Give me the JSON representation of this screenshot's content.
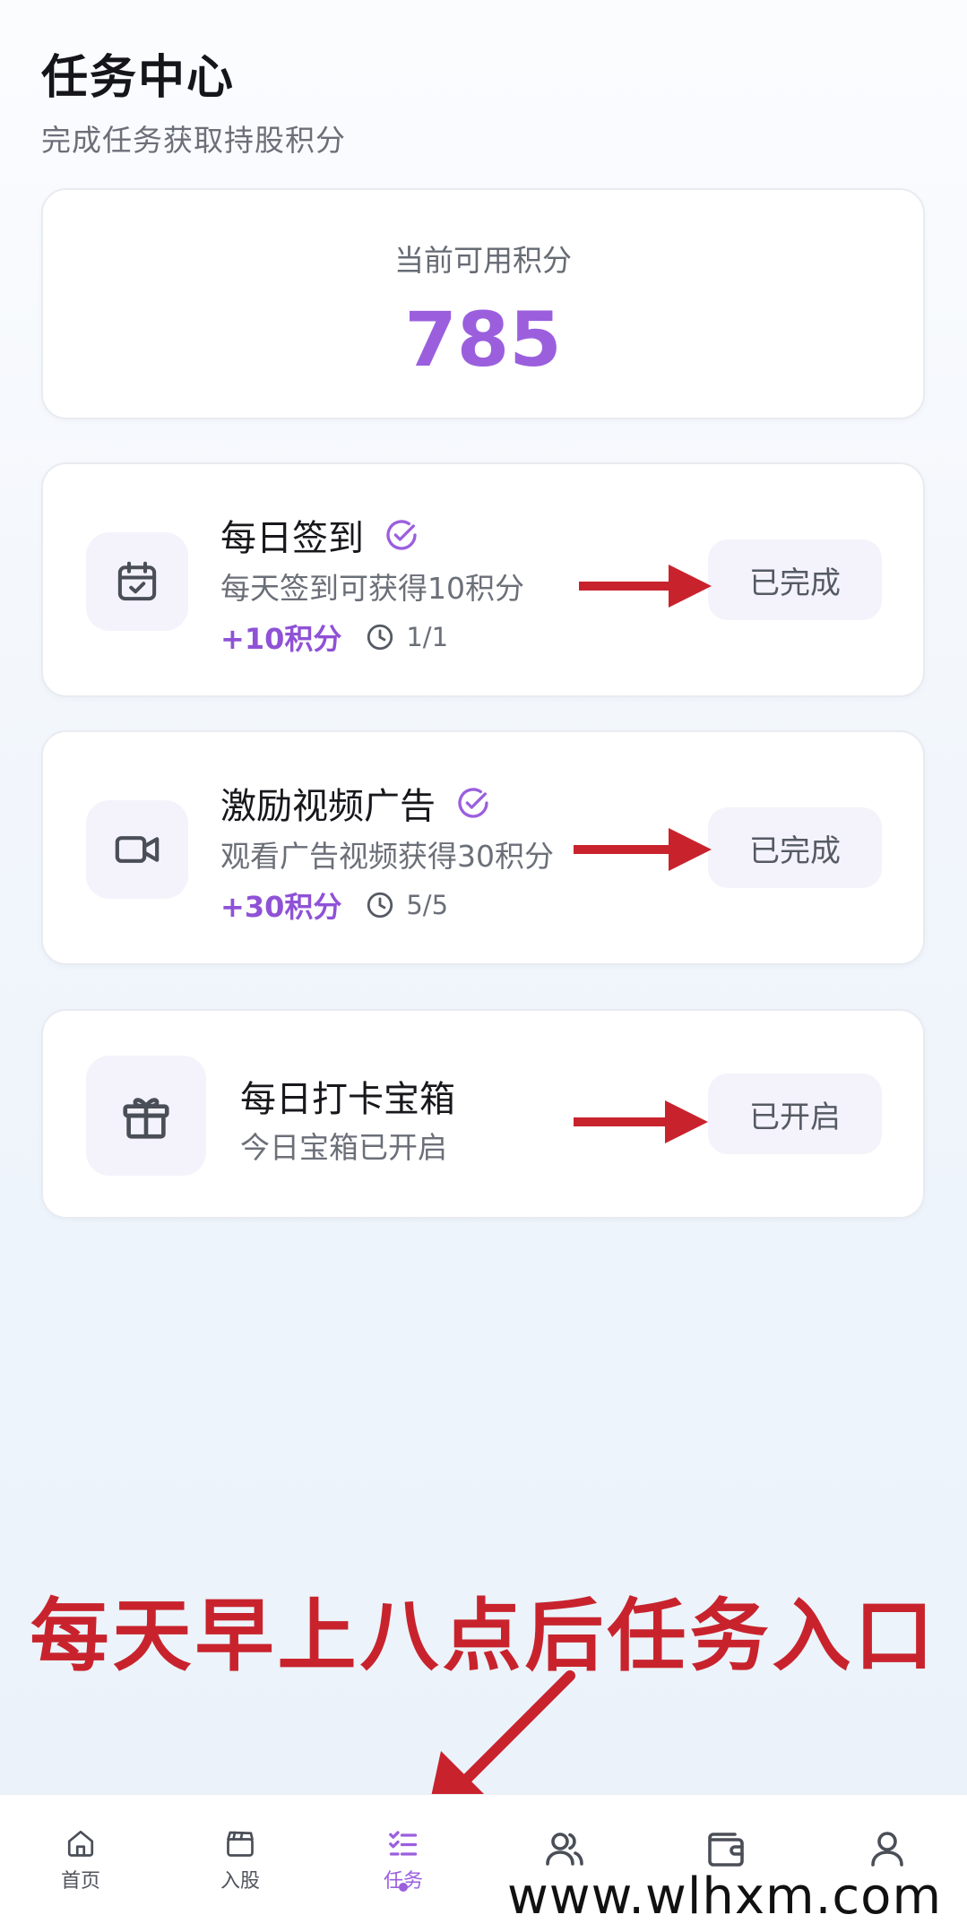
{
  "header": {
    "title": "任务中心",
    "subtitle": "完成任务获取持股积分"
  },
  "points": {
    "label": "当前可用积分",
    "value": "785"
  },
  "tasks": [
    {
      "name": "每日签到",
      "description": "每天签到可获得10积分",
      "reward": "+10积分",
      "progress": "1/1",
      "status": "已完成",
      "icon": "calendar-check-icon"
    },
    {
      "name": "激励视频广告",
      "description": "观看广告视频获得30积分",
      "reward": "+30积分",
      "progress": "5/5",
      "status": "已完成",
      "icon": "video-camera-icon"
    },
    {
      "name": "每日打卡宝箱",
      "description": "今日宝箱已开启",
      "status": "已开启",
      "icon": "gift-box-icon"
    }
  ],
  "banner": "每天早上八点后任务入口",
  "nav": {
    "items": [
      {
        "label": "首页",
        "icon": "home-icon"
      },
      {
        "label": "入股",
        "icon": "clapperboard-icon"
      },
      {
        "label": "任务",
        "icon": "task-list-icon",
        "active": true
      },
      {
        "label": "",
        "icon": "users-icon"
      },
      {
        "label": "",
        "icon": "wallet-icon"
      },
      {
        "label": "",
        "icon": "user-icon"
      }
    ]
  },
  "watermark": "www.wlhxm.com",
  "colors": {
    "accent": "#9b5fde",
    "annotation_red": "#c8232d"
  }
}
